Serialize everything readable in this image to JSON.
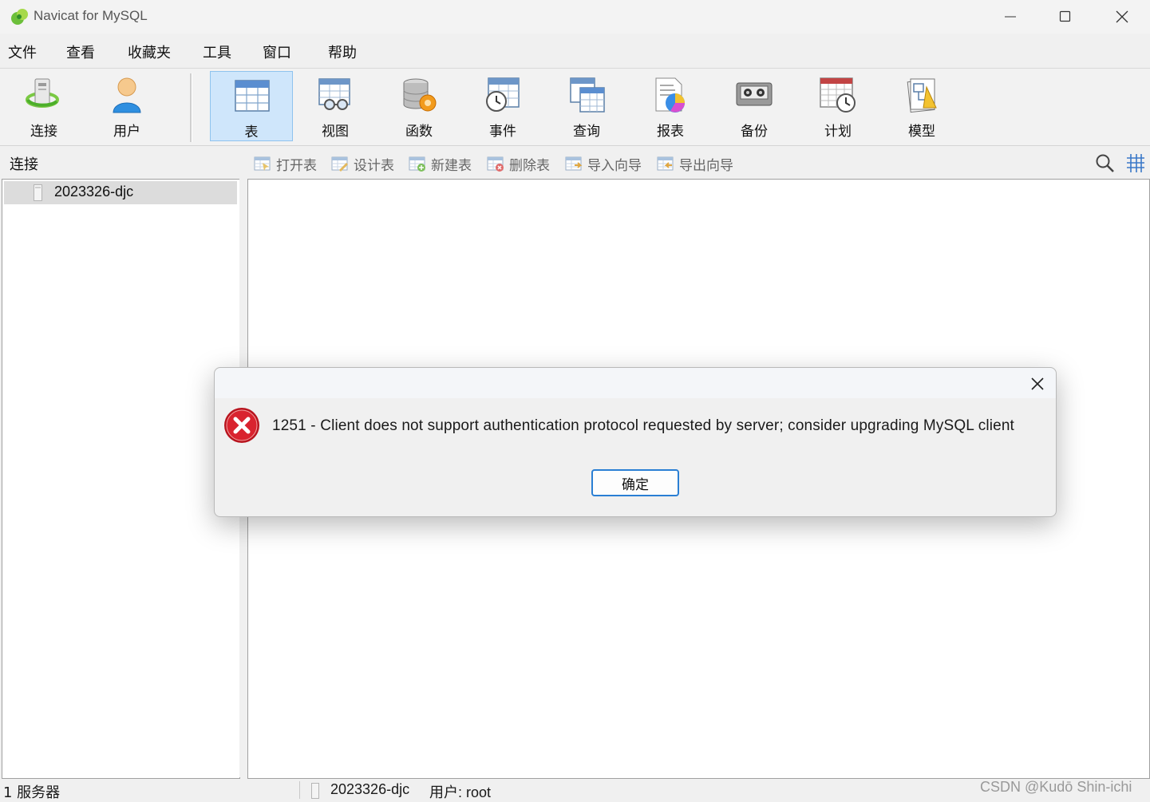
{
  "window": {
    "title": "Navicat for MySQL",
    "controls": [
      "minimize",
      "maximize",
      "close"
    ]
  },
  "menu": [
    "文件",
    "查看",
    "收藏夹",
    "工具",
    "窗口",
    "帮助"
  ],
  "toolbar": [
    {
      "label": "连接",
      "icon": "connect-icon"
    },
    {
      "label": "用户",
      "icon": "user-icon"
    },
    {
      "label": "表",
      "icon": "table-icon",
      "active": true
    },
    {
      "label": "视图",
      "icon": "view-icon"
    },
    {
      "label": "函数",
      "icon": "function-icon"
    },
    {
      "label": "事件",
      "icon": "event-icon"
    },
    {
      "label": "查询",
      "icon": "query-icon"
    },
    {
      "label": "报表",
      "icon": "report-icon"
    },
    {
      "label": "备份",
      "icon": "backup-icon"
    },
    {
      "label": "计划",
      "icon": "schedule-icon"
    },
    {
      "label": "模型",
      "icon": "model-icon"
    }
  ],
  "connection_panel": {
    "header": "连接",
    "items": [
      "2023326-djc"
    ]
  },
  "object_toolbar": [
    "打开表",
    "设计表",
    "新建表",
    "删除表",
    "导入向导",
    "导出向导"
  ],
  "status_bar": {
    "server_count": "1 服务器",
    "connection": "2023326-djc",
    "user": "用户: root"
  },
  "watermark": "CSDN @Kudō Shin-ichi",
  "dialog": {
    "icon": "error-icon",
    "message": "1251 - Client does not support authentication protocol requested by server; consider upgrading MySQL client",
    "ok_label": "确定"
  },
  "colors": {
    "active_tool_bg": "#cfe6fb",
    "active_tool_border": "#8fc3ee",
    "ok_button_border": "#2a7fd4",
    "error_red": "#c8202b"
  }
}
